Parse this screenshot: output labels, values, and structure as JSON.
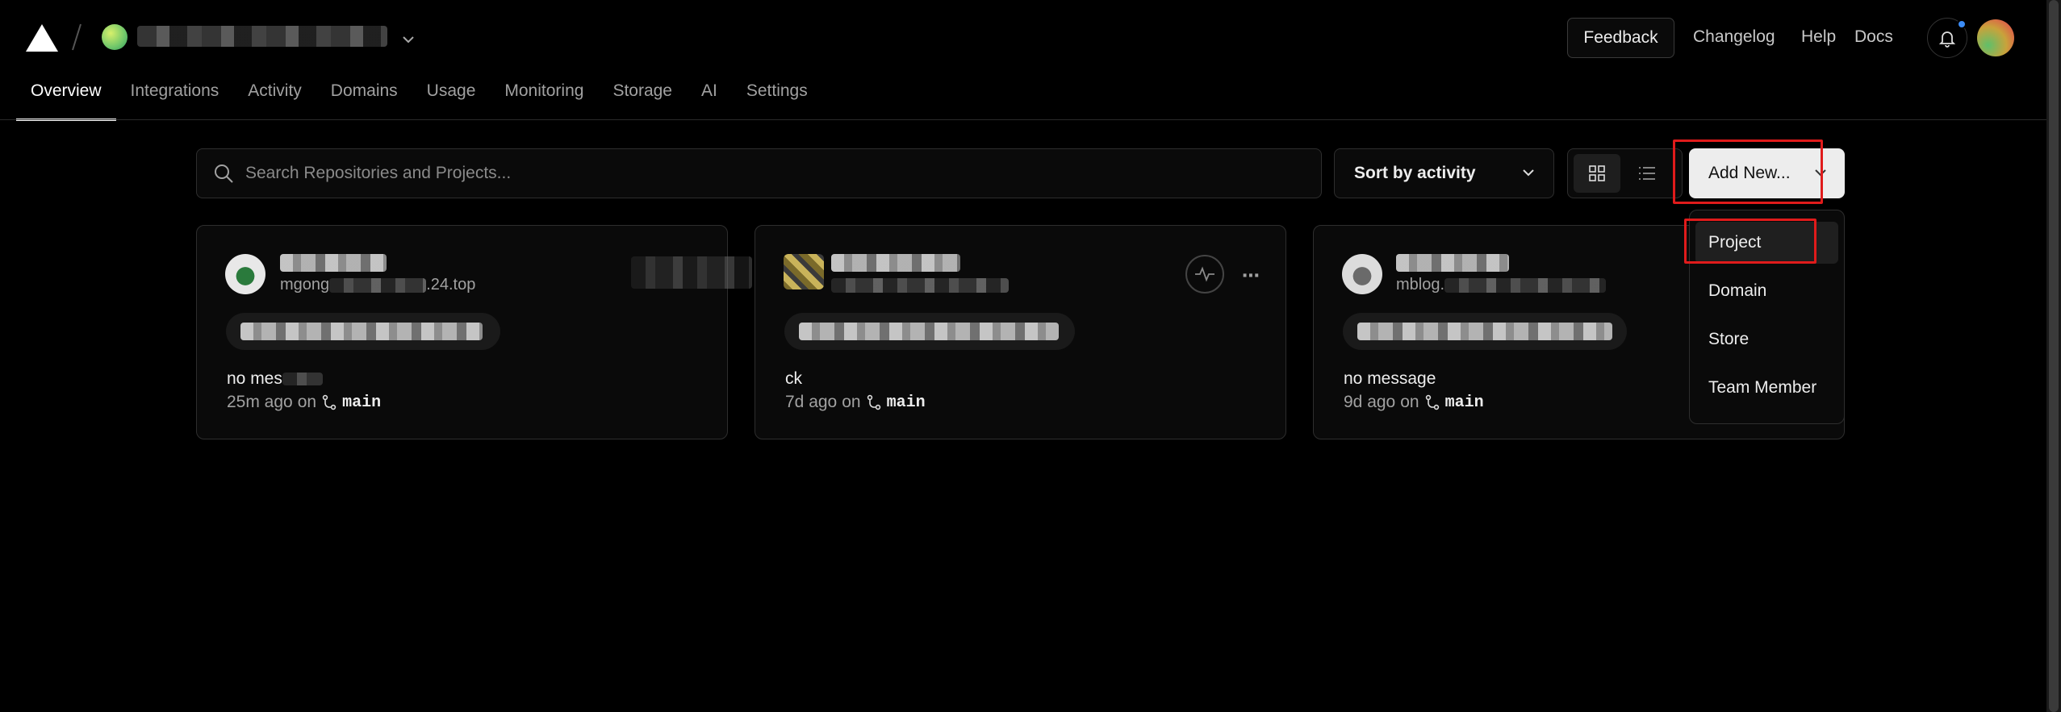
{
  "header": {
    "links": {
      "feedback": "Feedback",
      "changelog": "Changelog",
      "help": "Help",
      "docs": "Docs"
    }
  },
  "nav": {
    "tabs": [
      {
        "label": "Overview",
        "active": true
      },
      {
        "label": "Integrations"
      },
      {
        "label": "Activity"
      },
      {
        "label": "Domains"
      },
      {
        "label": "Usage"
      },
      {
        "label": "Monitoring"
      },
      {
        "label": "Storage"
      },
      {
        "label": "AI"
      },
      {
        "label": "Settings"
      }
    ]
  },
  "toolbar": {
    "search_placeholder": "Search Repositories and Projects...",
    "sort_label": "Sort by activity",
    "add_new_label": "Add New..."
  },
  "add_menu": {
    "items": [
      {
        "label": "Project",
        "selected": true
      },
      {
        "label": "Domain"
      },
      {
        "label": "Store"
      },
      {
        "label": "Team Member"
      }
    ]
  },
  "projects": [
    {
      "url_prefix": "mgong",
      "url_suffix": ".24.top",
      "commit_message": "no mes",
      "time": "25m ago",
      "on": "on",
      "branch": "main"
    },
    {
      "commit_message": "ck",
      "time": "7d ago",
      "on": "on",
      "branch": "main"
    },
    {
      "url_prefix": "mblog.",
      "commit_message": "no message",
      "time": "9d ago",
      "on": "on",
      "branch": "main"
    }
  ],
  "colors": {
    "background": "#000000",
    "highlight": "#e01b1b",
    "notification_dot": "#3b8cf6"
  }
}
